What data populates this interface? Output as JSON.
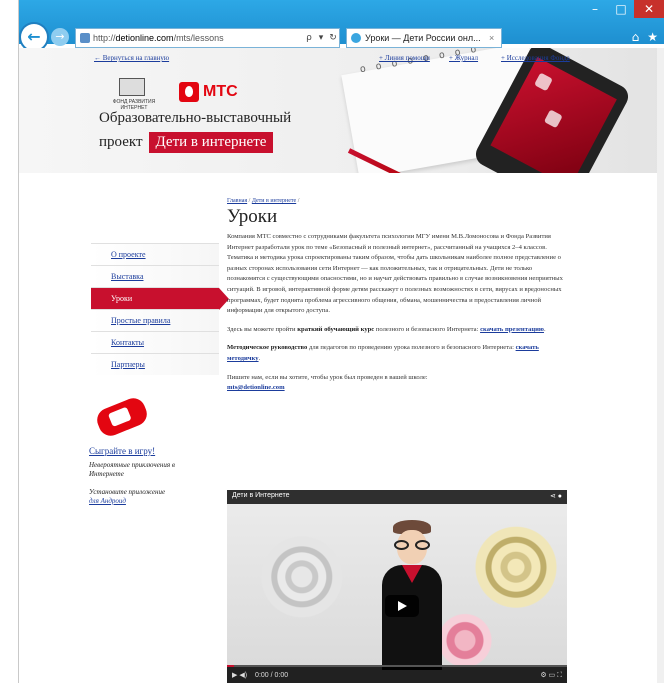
{
  "window": {
    "minimize_glyph": "–",
    "maximize_glyph": "□",
    "close_glyph": "✕"
  },
  "browser": {
    "back_glyph": "←",
    "forward_glyph": "→",
    "url_prefix": "http://",
    "url_domain": "detionline.com",
    "url_path": "/mts/lessons",
    "search_glyph": "ρ",
    "dropdown_glyph": "▾",
    "refresh_glyph": "↻",
    "tab_title": "Уроки — Дети России онл...",
    "tab_close": "×",
    "home_glyph": "⌂",
    "favorites_glyph": "★"
  },
  "header": {
    "top_links": {
      "home": "← Вернуться на главную",
      "hotline": "+ Линия помощи",
      "journal": "+ Журнал",
      "research": "+ Исследования Фонда"
    },
    "emblem_text": "ФОНД РАЗВИТИЯ ИНТЕРНЕТ",
    "mts_brand": "МТС",
    "project_line1": "Образовательно-выставочный",
    "project_line2": "проект",
    "project_badge": "Дети в интернете",
    "notebook_spiral": "o o o o o o o o"
  },
  "leftnav": {
    "items": [
      {
        "label": "О проекте"
      },
      {
        "label": "Выставка"
      },
      {
        "label": "Уроки"
      },
      {
        "label": "Простые правила"
      },
      {
        "label": "Контакты"
      },
      {
        "label": "Партнеры"
      }
    ],
    "active_index": 2,
    "play_link": "Сыграйте в игру!",
    "game_desc": "Невероятные приключения в Интернете",
    "install_text": "Установите приложение",
    "install_link": "для Андроид"
  },
  "content": {
    "breadcrumb_home": "Главная",
    "breadcrumb_sep": " / ",
    "breadcrumb_section": "Дети в интернете",
    "breadcrumb_tail": " /",
    "title": "Уроки",
    "intro": "Компания МТС совместно с сотрудниками факультета психологии МГУ имени М.В.Ломоносова и Фонда Развития Интернет разработали урок по теме «Безопасный и полезный интернет», рассчитанный на учащихся 2–4 классов. Тематика и методика урока спроектированы таким образом, чтобы дать школьникам наиболее полное представление о разных сторонах использования сети Интернет — как положительных, так и отрицательных. Дети не только познакомятся с существующими опасностями, но и научат действовать правильно в случае возникновения неприятных ситуаций. В игровой, интерактивной форме детям расскажут о полезных возможностях в сети, вирусах и вредоносных программах, будет поднята проблема агрессивного общения, обмана, мошенничества и предоставления личной информации для открытого доступа.",
    "p2_prefix": "Здесь вы можете пройти ",
    "p2_bold": "краткий обучающий курс",
    "p2_mid": " полезного и безопасного Интернета: ",
    "p2_link": "скачать презентацию",
    "p2_end": ".",
    "p3_bold": "Методическое руководство",
    "p3_mid": " для педагогов по проведению урока полезного и безопасного Интернета: ",
    "p3_link": "скачать методичку",
    "p3_end": ".",
    "p4_text": "Пишите нам, если вы хотите, чтобы урок был проведен в вашей школе:",
    "p4_email": "mts@detionline.com"
  },
  "video": {
    "title": "Дети в Интернете",
    "share_glyph": "⋖",
    "info_glyph": "●",
    "time": "0:00 / 0:00",
    "controls_left_glyphs": "▶   ◀)",
    "controls_right_glyphs": "⚙  ▭  ⛶",
    "progress": 0.02
  },
  "colors": {
    "accent_red": "#c8102e",
    "link_blue": "#1b3c9c",
    "titlebar_blue": "#1e8fd0"
  }
}
